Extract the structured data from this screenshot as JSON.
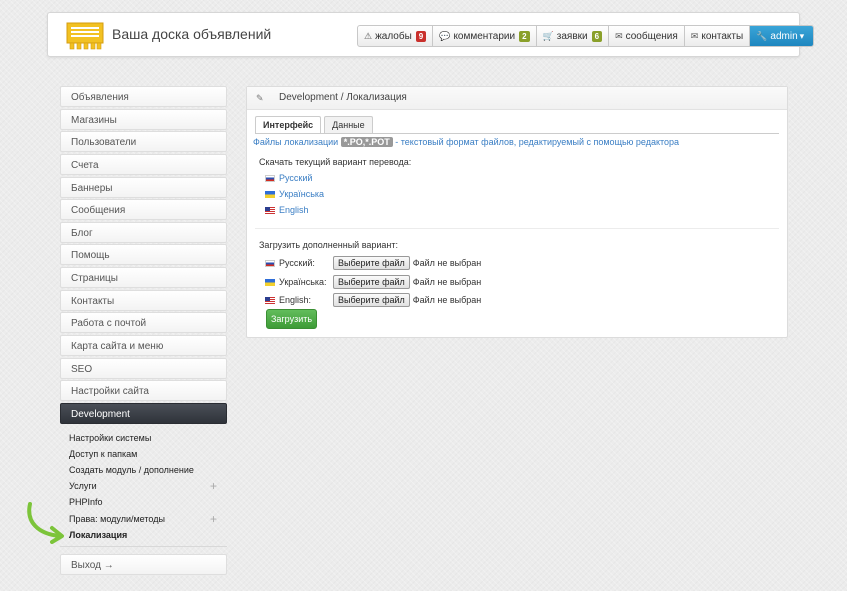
{
  "header": {
    "title": "Ваша доска объявлений",
    "nav": [
      {
        "icon": "warning-icon",
        "glyph": "⚠",
        "label": "жалобы",
        "badge": "9",
        "badge_color": "#c9302c"
      },
      {
        "icon": "comment-icon",
        "glyph": "💬",
        "label": "комментарии",
        "badge": "2",
        "badge_color": "#8aa02a"
      },
      {
        "icon": "cart-icon",
        "glyph": "🛒",
        "label": "заявки",
        "badge": "6",
        "badge_color": "#8aa02a"
      },
      {
        "icon": "envelope-icon",
        "glyph": "✉",
        "label": "сообщения",
        "badge": "",
        "badge_color": ""
      },
      {
        "icon": "envelope-icon",
        "glyph": "✉",
        "label": "контакты",
        "badge": "",
        "badge_color": ""
      }
    ],
    "admin": {
      "label": "admin",
      "icon": "wrench-icon"
    }
  },
  "sidebar": {
    "items": [
      "Объявления",
      "Магазины",
      "Пользователи",
      "Счета",
      "Баннеры",
      "Сообщения",
      "Блог",
      "Помощь",
      "Страницы",
      "Контакты",
      "Работа с почтой",
      "Карта сайта и меню",
      "SEO",
      "Настройки сайта"
    ],
    "active": "Development",
    "submenu": [
      {
        "label": "Настройки системы",
        "plus": false,
        "current": false
      },
      {
        "label": "Доступ к папкам",
        "plus": false,
        "current": false
      },
      {
        "label": "Создать модуль / дополнение",
        "plus": false,
        "current": false
      },
      {
        "label": "Услуги",
        "plus": true,
        "current": false
      },
      {
        "label": "PHPInfo",
        "plus": false,
        "current": false
      },
      {
        "label": "Права: модули/методы",
        "plus": true,
        "current": false
      },
      {
        "label": "Локализация",
        "plus": false,
        "current": true
      }
    ],
    "exit": "Выход →"
  },
  "panel": {
    "breadcrumb": "Development / Локализация",
    "tabs": [
      {
        "label": "Интерфейс",
        "active": true
      },
      {
        "label": "Данные",
        "active": false
      }
    ],
    "info_prefix": "Файлы локализации",
    "info_format": "*.PO,*.POT",
    "info_suffix": "- текстовый формат файлов, редактируемый с помощью редактора",
    "download_label": "Скачать текущий вариант перевода:",
    "languages": [
      {
        "label": "Русский",
        "flag": "ru"
      },
      {
        "label": "Українська",
        "flag": "ua"
      },
      {
        "label": "English",
        "flag": "us"
      }
    ],
    "upload_label": "Загрузить дополненный вариант:",
    "upload_rows": [
      {
        "label": "Русский:",
        "flag": "ru"
      },
      {
        "label": "Українська:",
        "flag": "ua"
      },
      {
        "label": "English:",
        "flag": "us"
      }
    ],
    "file_button": "Выберите файл",
    "no_file": "Файл не выбран",
    "submit": "Загрузить"
  }
}
